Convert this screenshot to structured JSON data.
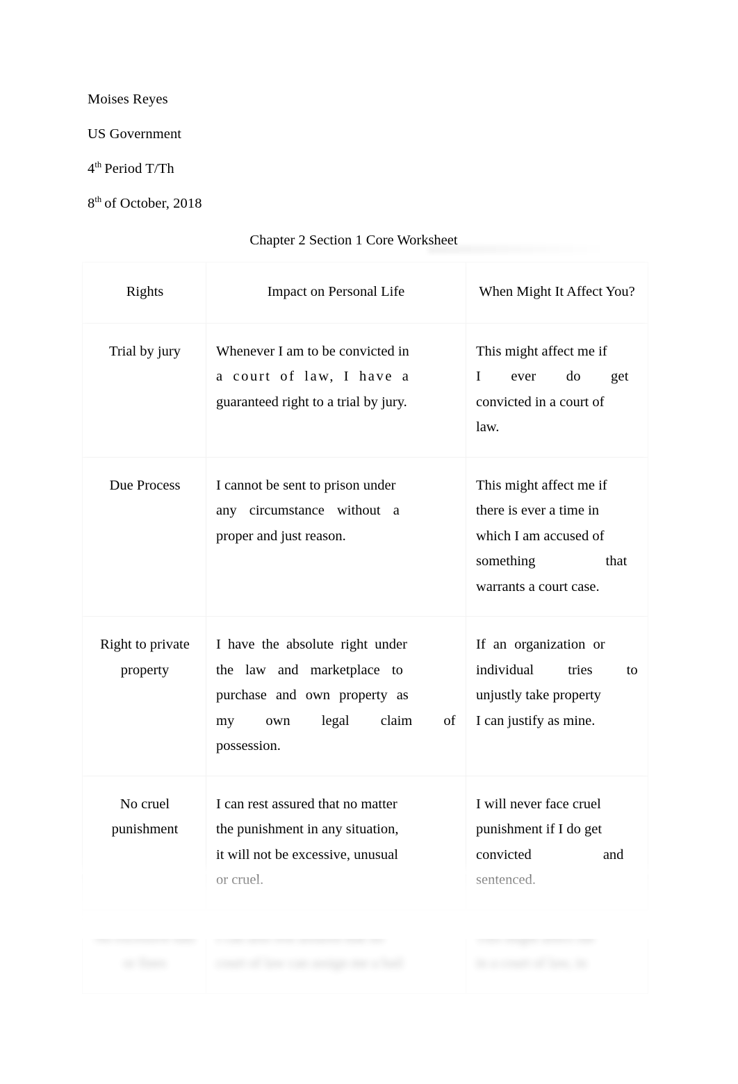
{
  "document": {
    "background_color": "#ffffff",
    "text_color": "#000000",
    "border_color": "#f2f2f2"
  },
  "heading": {
    "name": "Moises Reyes",
    "course": "US Government",
    "period_number": "4",
    "period_ordinal": "th",
    "period_text": "Period T/Th",
    "date_number": "8",
    "date_ordinal": "th",
    "date_text": "of October, 2018"
  },
  "title": "Chapter 2 Section 1 Core Worksheet",
  "table": {
    "headers": {
      "rights": "Rights",
      "impact": "Impact on Personal Life",
      "when": "When Might It Affect You?"
    },
    "rows": [
      {
        "right": "Trial by jury",
        "impact_line_1": "Whenever I am to be convicted in",
        "impact_line_2": "a court of law, I have a",
        "impact_line_3": "guaranteed right to a trial by jury.",
        "when_line_1": "This might affect me if",
        "when_line_2": "I ever do get",
        "when_line_3": "convicted in a court of",
        "when_line_4": "law."
      },
      {
        "right": "Due Process",
        "impact_line_1": "I cannot be sent to prison under",
        "impact_line_2": "any circumstance without a",
        "impact_line_3": "proper and just reason.",
        "when_line_1": "This might affect me if",
        "when_line_2": "there is ever a time in",
        "when_line_3": "which I am accused of",
        "when_line_4": "something that",
        "when_line_5": "warrants a court case."
      },
      {
        "right": "Right to private property",
        "impact_line_1": "I have the absolute right under",
        "impact_line_2": "the law and marketplace to",
        "impact_line_3": "purchase and own property as",
        "impact_line_4": "my own legal claim of",
        "impact_line_5": "possession.",
        "when_line_1": "If an organization or",
        "when_line_2": "individual tries to",
        "when_line_3": "unjustly take property",
        "when_line_4": "I can justify as mine."
      },
      {
        "right": "No cruel punishment",
        "impact_line_1": "I can rest assured that no matter",
        "impact_line_2": "the punishment in any situation,",
        "impact_line_3": "it will not be excessive, unusual",
        "impact_line_4": "or cruel.",
        "when_line_1": "I will never face cruel",
        "when_line_2": "punishment if I do get",
        "when_line_3": "convicted and",
        "when_line_4": "sentenced."
      },
      {
        "right": "No excessive bail or fines",
        "impact_line_1": "I can also rest assured that no",
        "impact_line_2": "court of law can assign me a bail",
        "when_line_1": "This might affect me",
        "when_line_2": "in a court of law, in"
      }
    ]
  }
}
